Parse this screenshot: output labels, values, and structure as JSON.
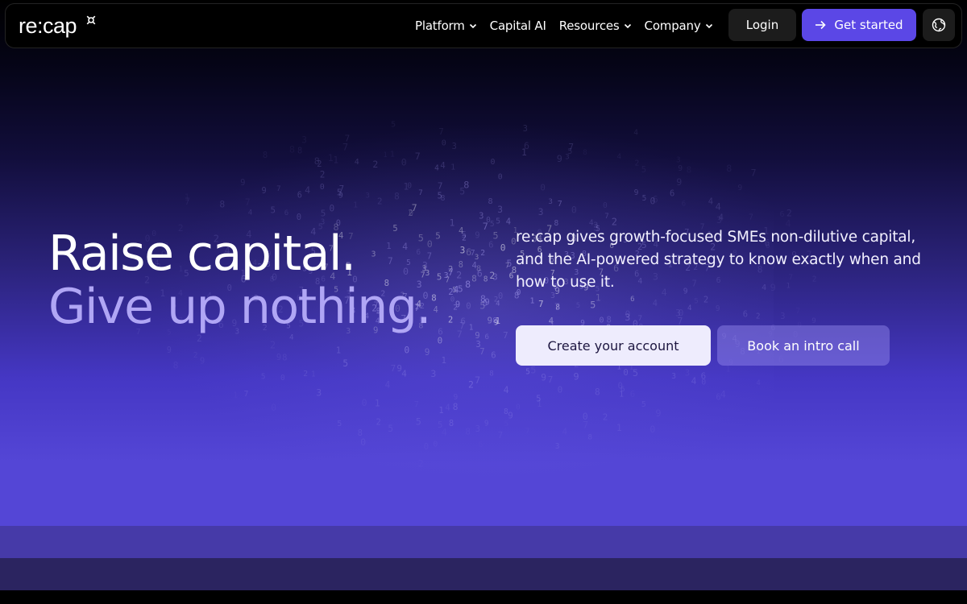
{
  "header": {
    "logo_text": "re:cap",
    "nav": [
      {
        "label": "Platform",
        "has_dropdown": true
      },
      {
        "label": "Capital AI",
        "has_dropdown": false
      },
      {
        "label": "Resources",
        "has_dropdown": true
      },
      {
        "label": "Company",
        "has_dropdown": true
      }
    ],
    "login_label": "Login",
    "get_started_label": "Get started",
    "icons": {
      "logo_mark": "currency-sign-icon",
      "dropdown": "chevron-down-icon",
      "get_started": "arrow-right-icon",
      "language": "globe-icon"
    }
  },
  "hero": {
    "headline_line1": "Raise capital.",
    "headline_line2": "Give up nothing.",
    "description": "re:cap gives growth-focused SMEs non-dilutive capital, and the AI-powered strategy to know exactly when and how to use it.",
    "create_account_label": "Create your account",
    "book_call_label": "Book an intro call"
  },
  "colors": {
    "accent": "#5b47e6",
    "headline_secondary": "#b0a6f5",
    "hero_bottom": "#5446d6",
    "button_light": "#eeecfd"
  }
}
